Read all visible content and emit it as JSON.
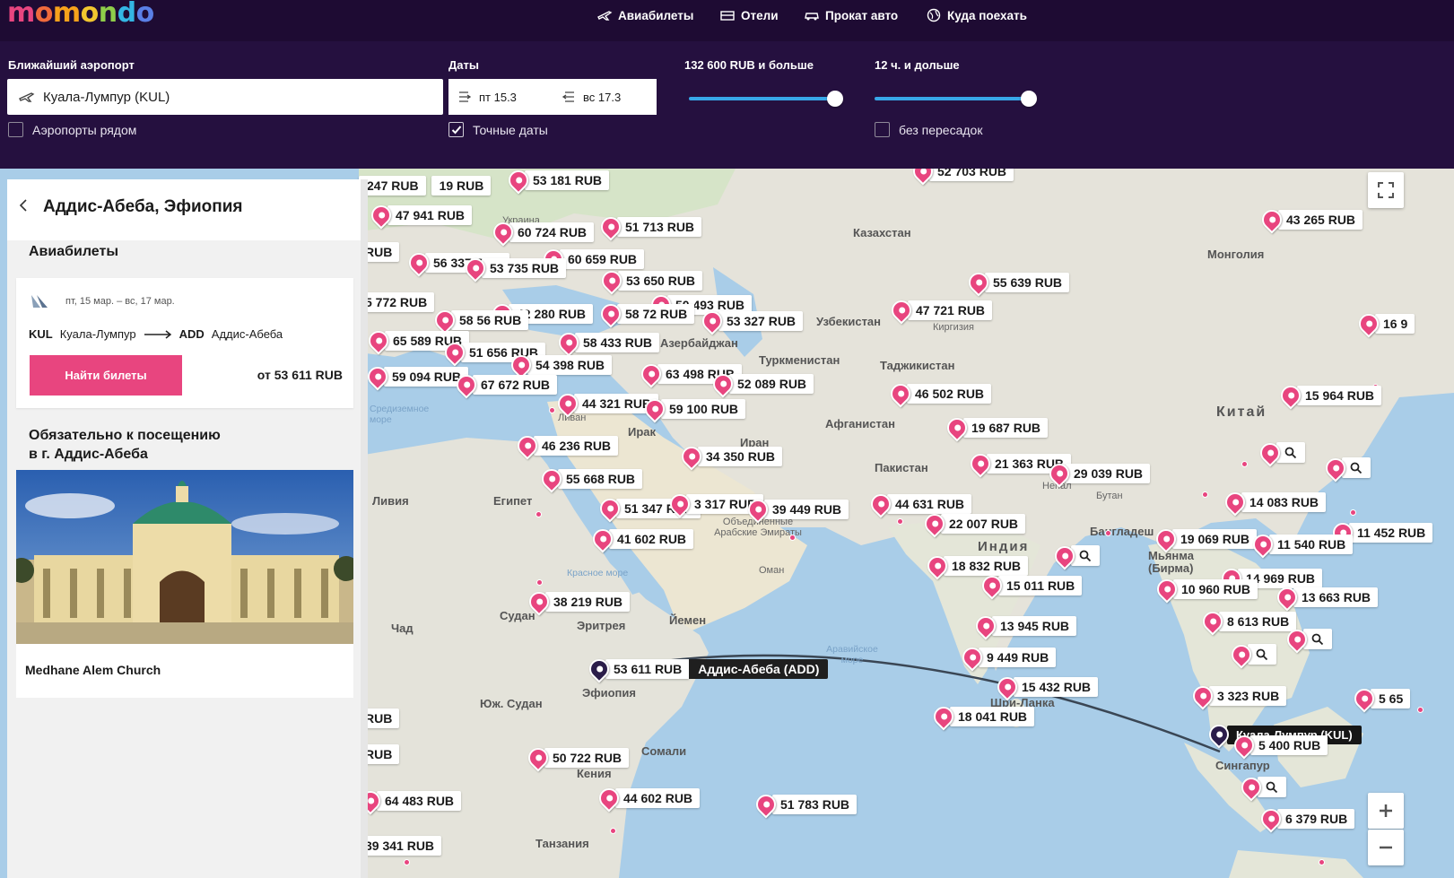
{
  "brand": {
    "logo": "momondo"
  },
  "nav": [
    {
      "label": "Авиабилеты",
      "icon": "plane-icon"
    },
    {
      "label": "Отели",
      "icon": "hotel-icon"
    },
    {
      "label": "Прокат авто",
      "icon": "car-icon"
    },
    {
      "label": "Куда поехать",
      "icon": "globe-icon"
    }
  ],
  "filters": {
    "airport_label": "Ближайший аэропорт",
    "airport_value": "Куала-Лумпур (KUL)",
    "nearby_label": "Аэропорты рядом",
    "nearby_checked": false,
    "dates_label": "Даты",
    "date_from": "пт 15.3",
    "date_to": "вс 17.3",
    "exact_label": "Точные даты",
    "exact_checked": true,
    "price_label": "132 600  RUB и больше",
    "price_level": 1.0,
    "duration_label": "12 ч. и дольше",
    "duration_level": 1.0,
    "nonstop_label": "без пересадок",
    "nonstop_checked": false
  },
  "panel": {
    "city": "Аддис-Абеба, Эфиопия",
    "flights_title": "Авиабилеты",
    "dates": "пт, 15 мар. – вс, 17 мар.",
    "from_code": "KUL",
    "from_city": "Куала-Лумпур",
    "to_code": "ADD",
    "to_city": "Аддис-Абеба",
    "find_button": "Найти билеты",
    "from_price": "от 53 611  RUB",
    "must_see_line1": "Обязательно к посещению",
    "must_see_line2": "в г. Аддис-Абеба",
    "attraction": "Medhane Alem Church"
  },
  "map": {
    "labels": [
      {
        "t": "Казахстан"
      },
      {
        "t": "Монголия"
      },
      {
        "t": "Узбекистан"
      },
      {
        "t": "Туркменистан"
      },
      {
        "t": "Таджикистан"
      },
      {
        "t": "Киргизия"
      },
      {
        "t": "Китай"
      },
      {
        "t": "Афганистан"
      },
      {
        "t": "Пакистан"
      },
      {
        "t": "Иран"
      },
      {
        "t": "Ирак"
      },
      {
        "t": "Ливан"
      },
      {
        "t": "Египет"
      },
      {
        "t": "Ливия"
      },
      {
        "t": "Чад"
      },
      {
        "t": "Судан"
      },
      {
        "t": "Эритрея"
      },
      {
        "t": "Йемен"
      },
      {
        "t": "Оман"
      },
      {
        "t": "Индия"
      },
      {
        "t": "Непал"
      },
      {
        "t": "Бутан"
      },
      {
        "t": "Бангладеш"
      },
      {
        "t": "Мьянма\n(Бирма)"
      },
      {
        "t": "Шри-Ланка"
      },
      {
        "t": "Эфиопия"
      },
      {
        "t": "Юж. Судан"
      },
      {
        "t": "Сомали"
      },
      {
        "t": "Кения"
      },
      {
        "t": "Танзания"
      },
      {
        "t": "Сингапур"
      },
      {
        "t": "Украина"
      },
      {
        "t": "Азербайджан"
      },
      {
        "t": "Средиземное море"
      },
      {
        "t": "Красное море"
      },
      {
        "t": "Аравийское море"
      },
      {
        "t": "Объединенные Арабские Эмираты"
      }
    ],
    "prices": [
      "52 703 RUB",
      "53 181 RUB",
      "47 941 RUB",
      "51 713 RUB",
      "60 724 RUB",
      "60 659 RUB",
      "56 337 RUB",
      "53 735 RUB",
      "53 650 RUB",
      "43 265 RUB",
      "55 639 RUB",
      "47 721 RUB",
      "50 493 RUB",
      "58 72 RUB",
      "53 327 RUB",
      "42 280 RUB",
      "58 56 RUB",
      "65 589 RUB",
      "51 656 RUB",
      "58 433 RUB",
      "54 398 RUB",
      "59 094 RUB",
      "67 672 RUB",
      "63 498 RUB",
      "52 089 RUB",
      "46 502 RUB",
      "15 964 RUB",
      "44 321 RUB",
      "59 100 RUB",
      "19 687 RUB",
      "46 236 RUB",
      "34 350 RUB",
      "21 363 RUB",
      "29 039 RUB",
      "55 668 RUB",
      "14 083 RUB",
      "51 347 RUB",
      "3 317 RUB",
      "39 449 RUB",
      "44 631 RUB",
      "22 007 RUB",
      "11 452 RUB",
      "41 602 RUB",
      "19 069 RUB",
      "11 540 RUB",
      "18 832 RUB",
      "15 011 RUB",
      "14 969 RUB",
      "10 960 RUB",
      "13 663 RUB",
      "38 219 RUB",
      "8 613 RUB",
      "13 945 RUB",
      "9 449 RUB",
      "53 611 RUB",
      "15 432 RUB",
      "3 323 RUB",
      "18 041 RUB",
      "5 400 RUB",
      "50 722 RUB",
      "44 602 RUB",
      "51 783 RUB",
      "64 483 RUB",
      "6 379 RUB",
      "16 9",
      "5 65",
      "247 RUB",
      "19 RUB",
      "5 772 RUB",
      "RUB",
      "RUB",
      "RUB",
      "39 341 RUB"
    ],
    "destination_label": "Аддис-Абеба (ADD)",
    "origin_label": "Куала-Лумпур (KUL)"
  },
  "colors": {
    "accent": "#e8457f",
    "nav_bg": "#1e0b33",
    "filter_bg": "#25103f",
    "slider": "#38a8e8"
  }
}
